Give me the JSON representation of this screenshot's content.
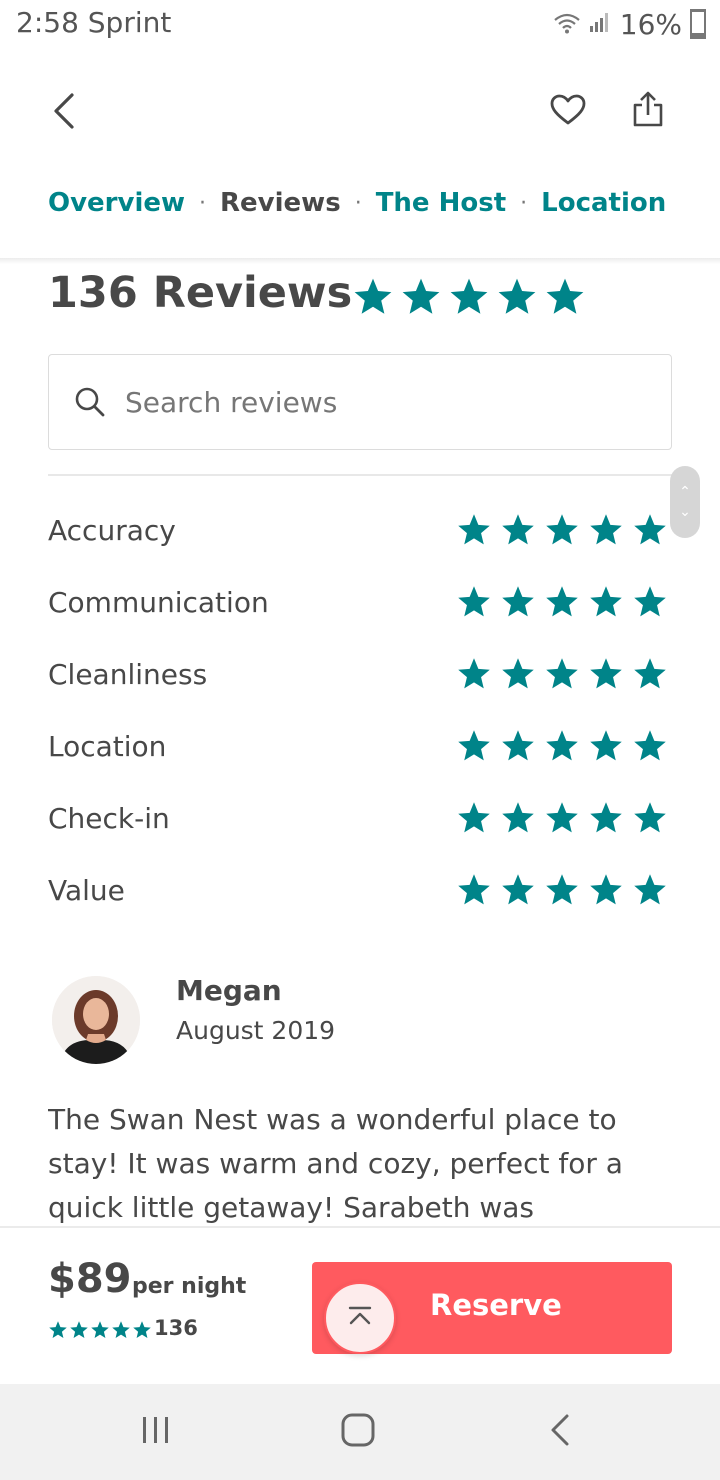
{
  "status_bar": {
    "time_carrier": "2:58 Sprint",
    "battery": "16%"
  },
  "header": {
    "tabs": [
      {
        "label": "Overview",
        "active": false
      },
      {
        "label": "Reviews",
        "active": true
      },
      {
        "label": "The Host",
        "active": false
      },
      {
        "label": "Location",
        "active": false
      }
    ],
    "separator": "·"
  },
  "reviews": {
    "title": "136 Reviews",
    "overall_rating": 5,
    "search_placeholder": "Search reviews",
    "categories": [
      {
        "label": "Accuracy",
        "rating": 5
      },
      {
        "label": "Communication",
        "rating": 5
      },
      {
        "label": "Cleanliness",
        "rating": 5
      },
      {
        "label": "Location",
        "rating": 5
      },
      {
        "label": "Check-in",
        "rating": 5
      },
      {
        "label": "Value",
        "rating": 5
      }
    ],
    "first_review": {
      "name": "Megan",
      "date": "August 2019",
      "text": "The Swan Nest was a wonderful place to stay! It was warm and cozy, perfect for a quick little getaway! Sarabeth was"
    }
  },
  "booking": {
    "price": "$89",
    "per_night": "per night",
    "rating": 5,
    "review_count": "136",
    "reserve_label": "Reserve"
  },
  "colors": {
    "teal": "#008489",
    "text": "#484848",
    "reserve": "#ff5a5f"
  },
  "icons": [
    "back-arrow-icon",
    "heart-icon",
    "share-icon",
    "search-icon",
    "star-icon",
    "chevron-up-icon",
    "chevron-down-icon",
    "scroll-top-icon",
    "recent-apps-icon",
    "home-icon",
    "android-back-icon"
  ]
}
